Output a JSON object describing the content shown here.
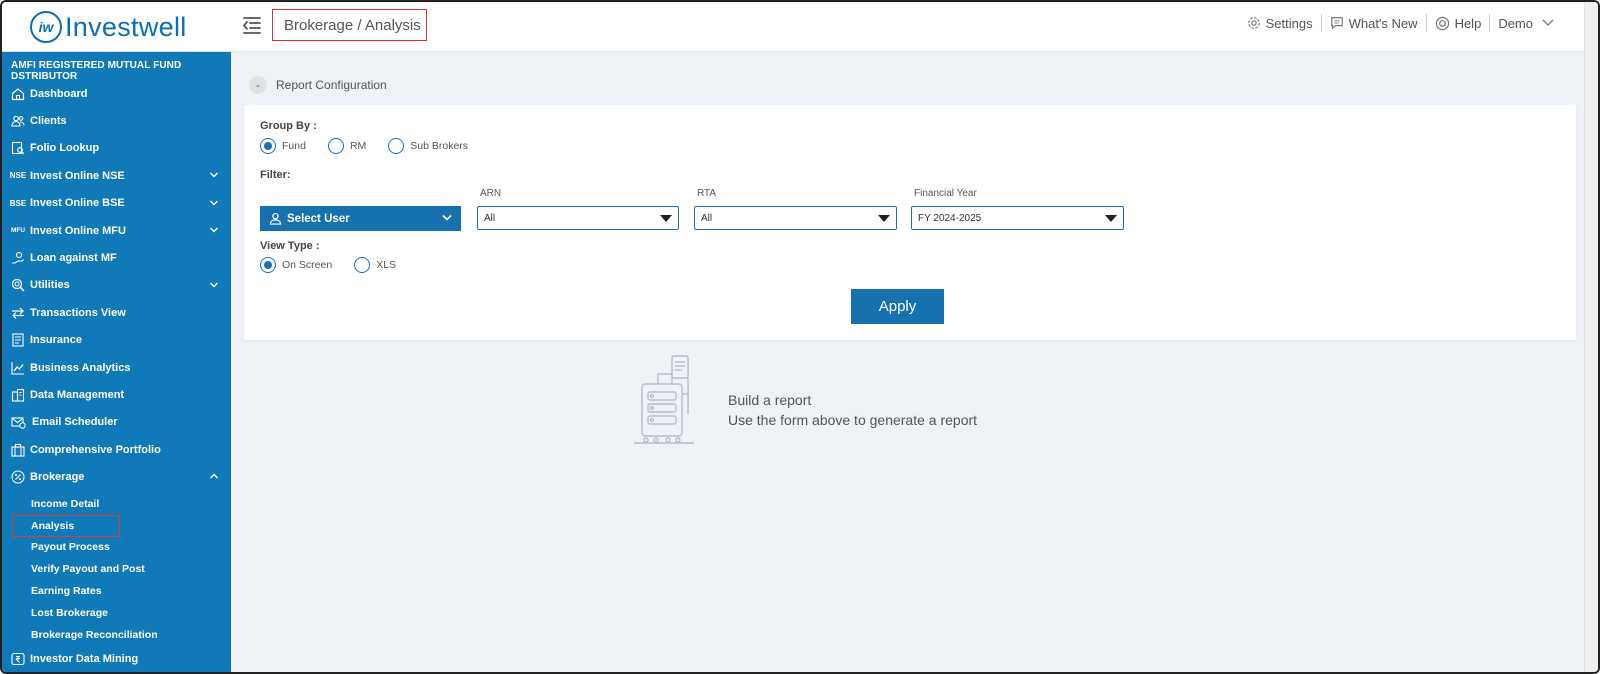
{
  "brand": {
    "logo_mark": "iw",
    "name": "Investwell",
    "color": "#0b6fb3"
  },
  "header": {
    "breadcrumb": "Brokerage / Analysis",
    "links": [
      {
        "label": "Settings",
        "icon": "gear-icon"
      },
      {
        "label": "What's New",
        "icon": "chat-icon"
      },
      {
        "label": "Help",
        "icon": "lifebuoy-icon"
      },
      {
        "label": "Demo",
        "icon": "chevron-down-icon"
      }
    ]
  },
  "sidebar": {
    "heading": "AMFI REGISTERED MUTUAL FUND DSTRIBUTOR",
    "items": [
      {
        "label": "Dashboard",
        "icon": "home-icon"
      },
      {
        "label": "Clients",
        "icon": "users-icon"
      },
      {
        "label": "Folio Lookup",
        "icon": "folio-icon"
      },
      {
        "label": "Invest Online NSE",
        "icon": "NSE",
        "expandable": true
      },
      {
        "label": "Invest Online BSE",
        "icon": "BSE",
        "expandable": true
      },
      {
        "label": "Invest Online MFU",
        "icon": "MFU",
        "expandable": true
      },
      {
        "label": "Loan against MF",
        "icon": "loan-icon"
      },
      {
        "label": "Utilities",
        "icon": "search-icon",
        "expandable": true
      },
      {
        "label": "Transactions View",
        "icon": "arrows-icon"
      },
      {
        "label": "Insurance",
        "icon": "document-icon"
      },
      {
        "label": "Business Analytics",
        "icon": "chart-icon"
      },
      {
        "label": "Data Management",
        "icon": "building-icon"
      },
      {
        "label": "Email Scheduler",
        "icon": "mail-icon"
      },
      {
        "label": "Comprehensive Portfolio",
        "icon": "briefcase-icon"
      },
      {
        "label": "Brokerage",
        "icon": "percent-icon",
        "expanded": true
      }
    ],
    "brokerage_sub": [
      "Income Detail",
      "Analysis",
      "Payout Process",
      "Verify Payout and Post",
      "Earning Rates",
      "Lost Brokerage",
      "Brokerage Reconciliation"
    ],
    "last_item": {
      "label": "Investor Data Mining",
      "icon": "rupee-icon"
    }
  },
  "report": {
    "section_title": "Report Configuration",
    "toggle_symbol": "-",
    "group_by_label": "Group By :",
    "group_by_options": [
      "Fund",
      "RM",
      "Sub Brokers"
    ],
    "group_by_selected": "Fund",
    "filter_label": "Filter:",
    "select_user_label": "Select User",
    "arn": {
      "label": "ARN",
      "value": "All"
    },
    "rta": {
      "label": "RTA",
      "value": "All"
    },
    "financial_year": {
      "label": "Financial Year",
      "value": "FY 2024-2025"
    },
    "view_type_label": "View Type :",
    "view_type_options": [
      "On Screen",
      "XLS"
    ],
    "view_type_selected": "On Screen",
    "apply_label": "Apply"
  },
  "empty_state": {
    "title": "Build a report",
    "subtitle": "Use the form above to generate a report"
  },
  "colors": {
    "sidebar": "#1079b8",
    "accent": "#1671ae",
    "highlight": "#d9322f",
    "background": "#eef1f5"
  }
}
